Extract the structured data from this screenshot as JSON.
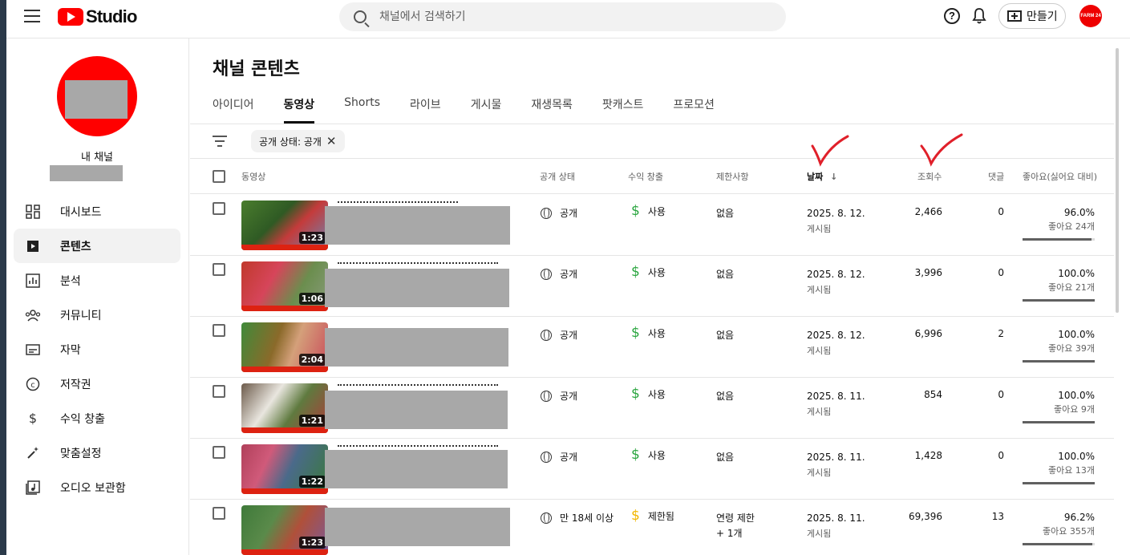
{
  "header": {
    "logo_text": "Studio",
    "search_placeholder": "채널에서 검색하기",
    "help_label": "?",
    "create_label": "만들기",
    "avatar_text": "FARM 24"
  },
  "sidebar": {
    "channel_label": "내 채널",
    "items": [
      {
        "label": "대시보드",
        "icon": "dashboard-icon"
      },
      {
        "label": "콘텐츠",
        "icon": "content-icon",
        "active": true
      },
      {
        "label": "분석",
        "icon": "analytics-icon"
      },
      {
        "label": "커뮤니티",
        "icon": "community-icon"
      },
      {
        "label": "자막",
        "icon": "subtitles-icon"
      },
      {
        "label": "저작권",
        "icon": "copyright-icon"
      },
      {
        "label": "수익 창출",
        "icon": "dollar-icon"
      },
      {
        "label": "맞춤설정",
        "icon": "magic-wand-icon"
      },
      {
        "label": "오디오 보관함",
        "icon": "audio-library-icon"
      }
    ]
  },
  "main": {
    "title": "채널 콘텐츠",
    "tabs": [
      "아이디어",
      "동영상",
      "Shorts",
      "라이브",
      "게시물",
      "재생목록",
      "팟캐스트",
      "프로모션"
    ],
    "active_tab": 1,
    "filter_chip": "공개 상태: 공개",
    "columns": {
      "video": "동영상",
      "visibility": "공개 상태",
      "monetization": "수익 창출",
      "restrictions": "제한사항",
      "date": "날짜",
      "views": "조회수",
      "comments": "댓글",
      "likes": "좋아요(싫어요 대비)"
    },
    "rows": [
      {
        "duration": "1:23",
        "visibility": "공개",
        "monetization": "사용",
        "restriction": "없음",
        "restriction2": "",
        "date": "2025. 8. 12.",
        "date_status": "게시됨",
        "views": "2,466",
        "comments": "0",
        "likes_pct": "96.0%",
        "likes_count": "좋아요 24개",
        "like_ratio": 0.96
      },
      {
        "duration": "1:06",
        "visibility": "공개",
        "monetization": "사용",
        "restriction": "없음",
        "restriction2": "",
        "date": "2025. 8. 12.",
        "date_status": "게시됨",
        "views": "3,996",
        "comments": "0",
        "likes_pct": "100.0%",
        "likes_count": "좋아요 21개",
        "like_ratio": 1.0
      },
      {
        "duration": "2:04",
        "visibility": "공개",
        "monetization": "사용",
        "restriction": "없음",
        "restriction2": "",
        "date": "2025. 8. 12.",
        "date_status": "게시됨",
        "views": "6,996",
        "comments": "2",
        "likes_pct": "100.0%",
        "likes_count": "좋아요 39개",
        "like_ratio": 1.0
      },
      {
        "duration": "1:21",
        "visibility": "공개",
        "monetization": "사용",
        "restriction": "없음",
        "restriction2": "",
        "date": "2025. 8. 11.",
        "date_status": "게시됨",
        "views": "854",
        "comments": "0",
        "likes_pct": "100.0%",
        "likes_count": "좋아요 9개",
        "like_ratio": 1.0
      },
      {
        "duration": "1:22",
        "visibility": "공개",
        "monetization": "사용",
        "restriction": "없음",
        "restriction2": "",
        "date": "2025. 8. 11.",
        "date_status": "게시됨",
        "views": "1,428",
        "comments": "0",
        "likes_pct": "100.0%",
        "likes_count": "좋아요 13개",
        "like_ratio": 1.0
      },
      {
        "duration": "1:23",
        "visibility": "만 18세 이상",
        "monetization": "제한됨",
        "restriction": "연령 제한",
        "restriction2": "+ 1개",
        "date": "2025. 8. 11.",
        "date_status": "게시됨",
        "views": "69,396",
        "comments": "13",
        "likes_pct": "96.2%",
        "likes_count": "좋아요 355개",
        "like_ratio": 0.962
      }
    ]
  },
  "colors": {
    "brand_red": "#ff0000",
    "monetized_green": "#2ba640",
    "limited_yellow": "#f2b600",
    "annotation_red": "#e0202a"
  }
}
